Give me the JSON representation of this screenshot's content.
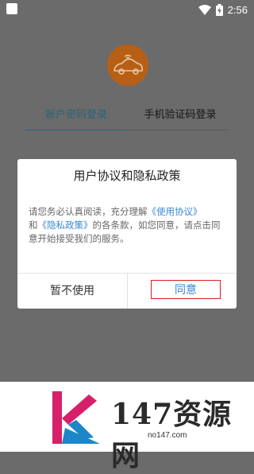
{
  "status_bar": {
    "time": "2:56",
    "icons": [
      "app-notification-icon",
      "wifi-icon",
      "battery-charging-icon"
    ]
  },
  "login": {
    "tabs": [
      {
        "label": "账户密码登录",
        "active": true
      },
      {
        "label": "手机验证码登录",
        "active": false
      }
    ],
    "accent_color": "#2a6378",
    "logo_color": "#b85f16"
  },
  "dialog": {
    "title": "用户协议和隐私政策",
    "body_parts": {
      "p1": "请您务必认真阅读，充分理解",
      "link1": "《使用协议》",
      "p2": "和",
      "link2": "《隐私政策》",
      "p3": "的各条款，如您同意，请点击同意开始接受我们的服务。"
    },
    "decline_label": "暂不使用",
    "agree_label": "同意",
    "link_color": "#3a86cf",
    "highlight_border_color": "#d81e1e"
  },
  "watermark": {
    "text": "147资源网",
    "url": "no147.com"
  }
}
